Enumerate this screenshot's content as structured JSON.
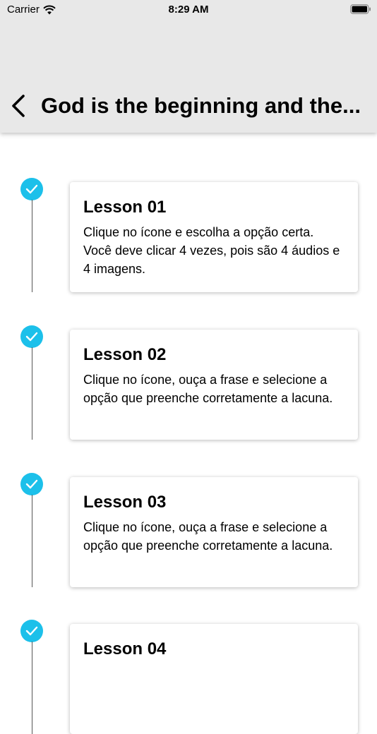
{
  "status_bar": {
    "carrier": "Carrier",
    "time": "8:29 AM"
  },
  "nav": {
    "title": "God is the beginning and the..."
  },
  "colors": {
    "accent": "#1cc0ea",
    "header_bg": "#e8e8e8"
  },
  "lessons": [
    {
      "title": "Lesson 01",
      "description": "Clique no ícone e escolha a opção certa. Você deve clicar 4 vezes, pois são 4 áudios e 4 imagens.",
      "completed": true
    },
    {
      "title": "Lesson 02",
      "description": "Clique no ícone, ouça a frase e selecione a opção que preenche corretamente a lacuna.",
      "completed": true
    },
    {
      "title": "Lesson 03",
      "description": "Clique no ícone, ouça a frase e selecione a opção que preenche corretamente a lacuna.",
      "completed": true
    },
    {
      "title": "Lesson 04",
      "description": "",
      "completed": true
    }
  ]
}
